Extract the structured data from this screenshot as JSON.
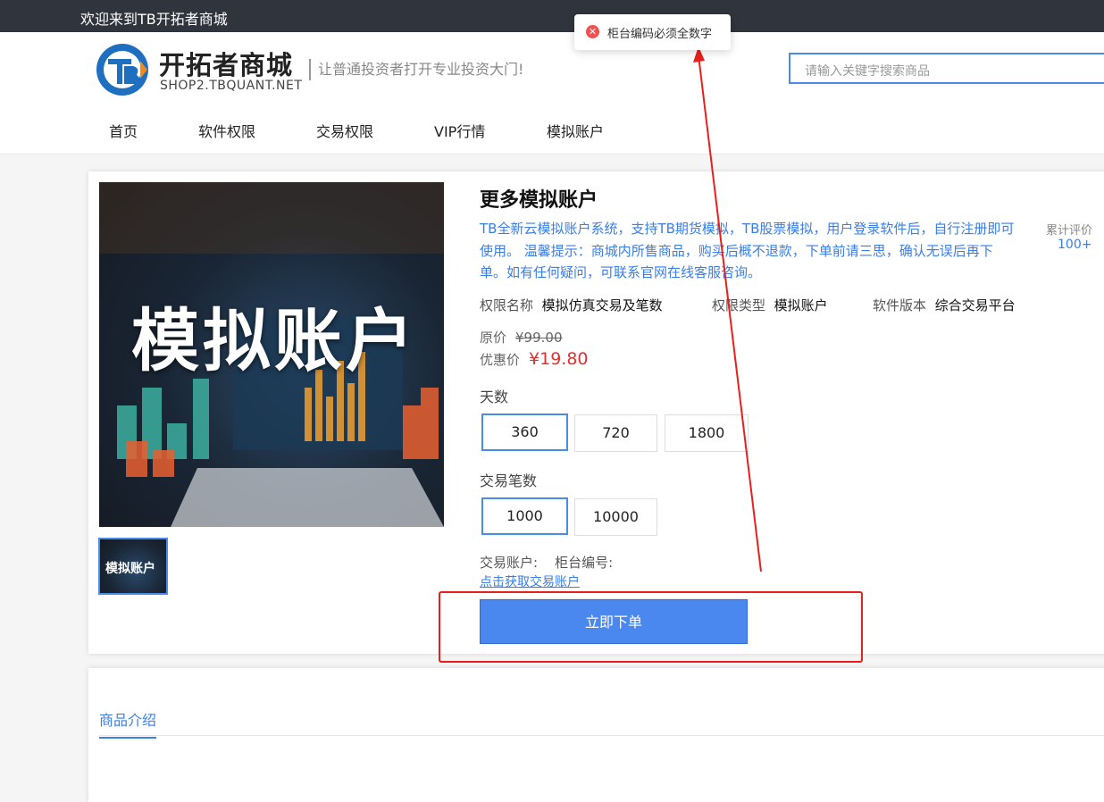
{
  "topbar": {
    "welcome": "欢迎来到TB开拓者商城"
  },
  "header": {
    "logo_title": "开拓者商城",
    "logo_sub": "SHOP2.TBQUANT.NET",
    "slogan": "让普通投资者打开专业投资大门!",
    "search_placeholder": "请输入关键字搜索商品"
  },
  "nav": [
    {
      "label": "首页"
    },
    {
      "label": "软件权限"
    },
    {
      "label": "交易权限"
    },
    {
      "label": "VIP行情"
    },
    {
      "label": "模拟账户"
    }
  ],
  "product": {
    "image_text": "模拟账户",
    "thumb_text": "模拟账户",
    "title": "更多模拟账户",
    "desc": "TB全新云模拟账户系统，支持TB期货模拟，TB股票模拟，用户登录软件后，自行注册即可使用。 温馨提示：商城内所售商品，购买后概不退款，下单前请三思，确认无误后再下单。如有任何疑问，可联系官网在线客服咨询。",
    "rating_label": "累计评价",
    "rating_value": "100+",
    "attrs": [
      {
        "key": "权限名称",
        "value": "模拟仿真交易及笔数"
      },
      {
        "key": "权限类型",
        "value": "模拟账户"
      },
      {
        "key": "软件版本",
        "value": "综合交易平台"
      }
    ],
    "orig_label": "原价",
    "orig_price": "¥99.00",
    "disc_label": "优惠价",
    "disc_price": "¥19.80",
    "days_label": "天数",
    "days": [
      "360",
      "720",
      "1800"
    ],
    "trades_label": "交易笔数",
    "trades": [
      "1000",
      "10000"
    ],
    "account_label": "交易账户:",
    "counter_label": "柜台编号:",
    "account_link": "点击获取交易账户",
    "order_button": "立即下单"
  },
  "intro": {
    "tab": "商品介绍"
  },
  "toast": {
    "message": "柜台编码必须全数字"
  },
  "colors": {
    "accent": "#4a88f0",
    "price": "#e03030",
    "annotation": "#e8201c"
  }
}
